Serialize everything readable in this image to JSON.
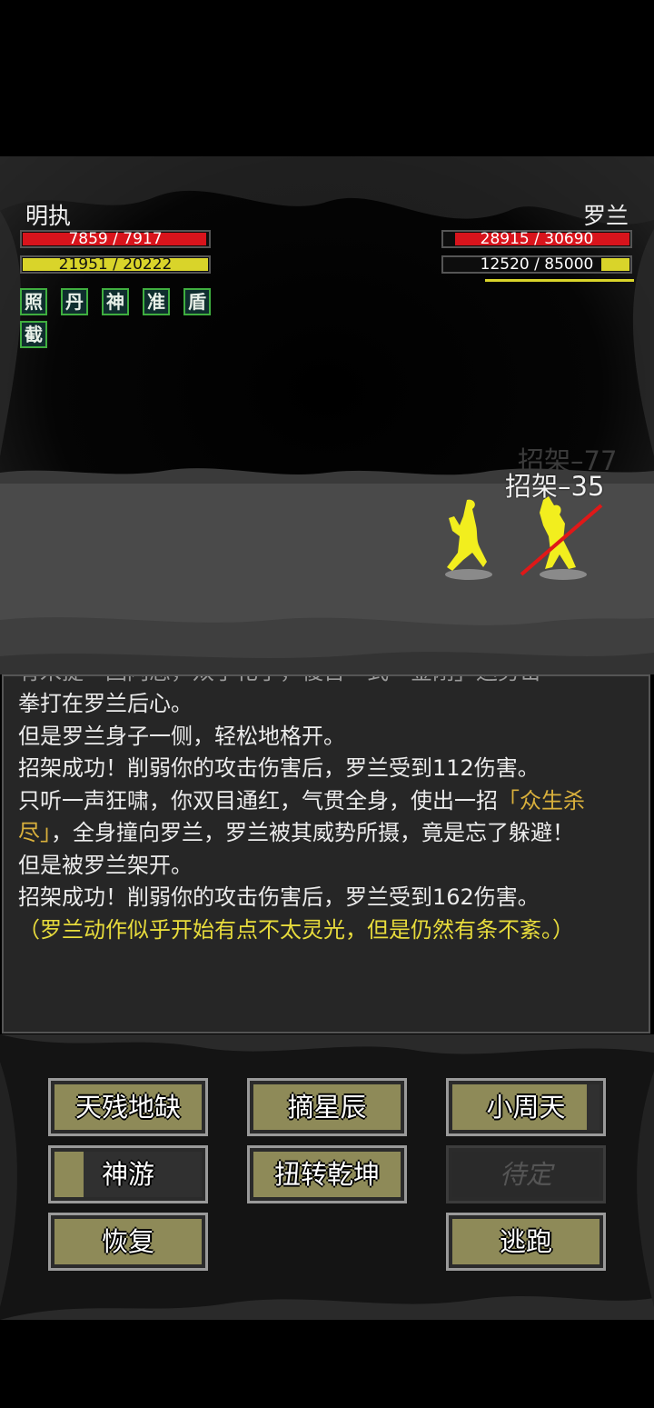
{
  "player": {
    "name": "明执",
    "hp_text": "7859 / 7917",
    "hp_ratio": 0.99,
    "mp_text": "21951 / 20222",
    "mp_ratio": 1.0,
    "buffs": [
      "照",
      "丹",
      "神",
      "准",
      "盾",
      "截"
    ]
  },
  "enemy": {
    "name": "罗兰",
    "hp_text": "28915 / 30690",
    "hp_ratio": 0.94,
    "mp_text": "12520 / 85000",
    "mp_ratio": 0.15
  },
  "floating_text": {
    "faded": "招架–77",
    "current": "招架–35"
  },
  "log": {
    "line_cut": "有米提一回闪忍，双手化了，復苜一式「金刚」运势击",
    "line1": "拳打在罗兰后心。",
    "line2": "但是罗兰身子一侧，轻松地格开。",
    "line3": "招架成功！削弱你的攻击伤害后，罗兰受到112伤害。",
    "line4a": "只听一声狂啸，你双目通红，气贯全身，使出一招",
    "skill_name": "「众生杀尽」",
    "line4b": "，全身撞向罗兰，罗兰被其威势所摄，竟是忘了躲避！",
    "line5": "但是被罗兰架开。",
    "line6": "招架成功！削弱你的攻击伤害后，罗兰受到162伤害。",
    "line7": "（罗兰动作似乎开始有点不太灵光，但是仍然有条不紊。）"
  },
  "buttons": {
    "b1": "天残地缺",
    "b2": "摘星辰",
    "b3": "小周天",
    "b4": "神游",
    "b5": "扭转乾坤",
    "b6": "待定",
    "b7": "恢复",
    "b8": "逃跑"
  },
  "colors": {
    "hp": "#d8141c",
    "mp": "#d9d42a",
    "button": "#8e8a58",
    "log_highlight": "#d9b03c",
    "note": "#e8dc3c",
    "buff_border": "#3fae3f",
    "fighter": "#f2ee1e"
  }
}
